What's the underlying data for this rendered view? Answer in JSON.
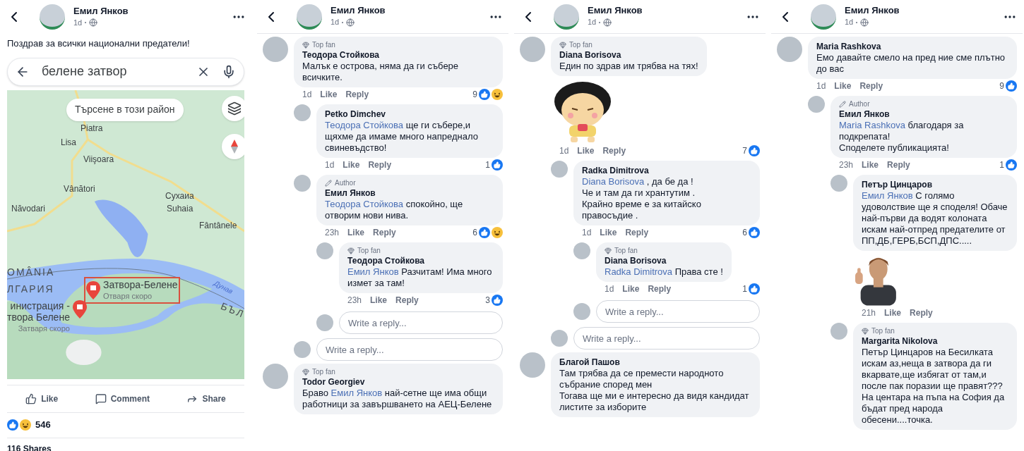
{
  "panels": [
    {
      "kind": "post",
      "header": {
        "name": "Емил Янков",
        "time": "1d"
      },
      "post": {
        "text": "Поздрав за всички национални предатели!",
        "map": {
          "search": {
            "value": "белене затвор"
          },
          "area_button": "Търсене в този район",
          "labels": [
            {
              "kind": "town",
              "text": "Piatra"
            },
            {
              "kind": "town",
              "text": "Lisa"
            },
            {
              "kind": "town",
              "text": "Viişoara"
            },
            {
              "kind": "town",
              "text": "Vânători"
            },
            {
              "kind": "town",
              "text": "Năvodari"
            },
            {
              "kind": "town",
              "text": "Сухаиа"
            },
            {
              "kind": "town",
              "text": "Suhaia"
            },
            {
              "kind": "town",
              "text": "Fântânele"
            },
            {
              "kind": "country",
              "text": "OMÂNIA"
            },
            {
              "kind": "country",
              "text": "ЛГАРИЯ"
            },
            {
              "kind": "river",
              "text": "Дунав"
            },
            {
              "kind": "country",
              "text": "БЪЛ"
            }
          ],
          "places": [
            {
              "name": "Затвора-Белене",
              "status": "Отваря скоро",
              "highlighted": true
            },
            {
              "name": "инистрация -\nтвора Белене",
              "status": "Затваря скоро",
              "highlighted": false
            }
          ]
        },
        "actions": [
          {
            "kind": "like",
            "label": "Like"
          },
          {
            "kind": "comment",
            "label": "Comment"
          },
          {
            "kind": "share",
            "label": "Share"
          }
        ],
        "reactions": [
          {
            "kind": "like"
          },
          {
            "kind": "haha"
          }
        ],
        "reaction_count": "546",
        "shares": "116 Shares"
      }
    },
    {
      "kind": "comments",
      "header": {
        "name": "Емил Янков",
        "time": "1d"
      },
      "comments": [
        {
          "badge": {
            "kind": "top_fan",
            "label": "Top fan"
          },
          "name": "Теодора Стойкова",
          "text": "Малък е острова, няма да ги събере всичките.",
          "time": "1d",
          "actions": [
            "Like",
            "Reply"
          ],
          "count": "9",
          "reactions": [
            {
              "kind": "like"
            },
            {
              "kind": "haha"
            }
          ],
          "replies": [
            {
              "name": "Petko Dimchev",
              "mention": "Теодора Стойкова",
              "text": "ще ги събере,и щяхме да имаме много напреднало свиневъдство!",
              "time": "1d",
              "actions": [
                "Like",
                "Reply"
              ],
              "count": "1",
              "reactions": [
                {
                  "kind": "like"
                }
              ]
            },
            {
              "badge": {
                "kind": "author",
                "label": "Author"
              },
              "name": "Емил Янков",
              "mention": "Теодора Стойкова",
              "text": "спокойно, ще отворим нови нива.",
              "time": "23h",
              "actions": [
                "Like",
                "Reply"
              ],
              "count": "6",
              "reactions": [
                {
                  "kind": "like"
                },
                {
                  "kind": "haha"
                }
              ],
              "replies": [
                {
                  "badge": {
                    "kind": "top_fan",
                    "label": "Top fan"
                  },
                  "name": "Теодора Стойкова",
                  "mention": "Емил Янков",
                  "text": "Разчитам! Има много измет за там!",
                  "time": "23h",
                  "actions": [
                    "Like",
                    "Reply"
                  ],
                  "count": "3",
                  "reactions": [
                    {
                      "kind": "like"
                    }
                  ]
                }
              ],
              "reply_box": {
                "placeholder": "Write a reply..."
              }
            }
          ],
          "reply_box": {
            "placeholder": "Write a reply..."
          }
        },
        {
          "badge": {
            "kind": "top_fan",
            "label": "Top fan"
          },
          "name": "Todor Georgiev",
          "prefix": "Браво",
          "mention": "Емил Янков",
          "text": "най-сетне ще има общи работници за завършването на АЕЦ-Белене"
        }
      ]
    },
    {
      "kind": "comments",
      "header": {
        "name": "Емил Янков",
        "time": "1d"
      },
      "comments": [
        {
          "badge": {
            "kind": "top_fan",
            "label": "Top fan"
          },
          "name": "Diana Borisova",
          "text": "Един по здрав им трябва на тях!",
          "sticker": {
            "kind": "girl"
          },
          "time": "1d",
          "actions": [
            "Like",
            "Reply"
          ],
          "count": "7",
          "reactions": [
            {
              "kind": "like"
            }
          ],
          "replies": [
            {
              "name": "Radka Dimitrova",
              "mention": "Diana Borisova",
              "text": ", да бе да !\nЧе и там да ги хрантутим .\nКрайно време е за китайско правосъдие .",
              "time": "1d",
              "actions": [
                "Like",
                "Reply"
              ],
              "count": "6",
              "reactions": [
                {
                  "kind": "like"
                }
              ],
              "replies": [
                {
                  "badge": {
                    "kind": "top_fan",
                    "label": "Top fan"
                  },
                  "name": "Diana Borisova",
                  "mention": "Radka Dimitrova",
                  "text": "Права сте !",
                  "time": "1d",
                  "actions": [
                    "Like",
                    "Reply"
                  ],
                  "count": "1",
                  "reactions": [
                    {
                      "kind": "like"
                    }
                  ]
                }
              ],
              "reply_box": {
                "placeholder": "Write a reply..."
              }
            }
          ],
          "reply_box": {
            "placeholder": "Write a reply..."
          }
        },
        {
          "name": "Благой Пашов",
          "text": "Там трябва да се премести народното събрание според мен\nТогава ще ми е интересно да видя кандидат листите за изборите"
        }
      ]
    },
    {
      "kind": "comments",
      "header": {
        "name": "Емил Янков",
        "time": "1d"
      },
      "comments": [
        {
          "name": "Maria Rashkova",
          "text": "Емо давайте смело на пред ние сме плътно до вас",
          "time": "1d",
          "actions": [
            "Like",
            "Reply"
          ],
          "count": "9",
          "reactions": [
            {
              "kind": "like"
            }
          ],
          "replies": [
            {
              "badge": {
                "kind": "author",
                "label": "Author"
              },
              "name": "Емил Янков",
              "mention": "Maria Rashkova",
              "text": "благодаря за подкрепата!\nСподелете публикацията!",
              "time": "23h",
              "actions": [
                "Like",
                "Reply"
              ],
              "count": "1",
              "reactions": [
                {
                  "kind": "like"
                }
              ],
              "replies": [
                {
                  "name": "Петър Цинцаров",
                  "mention": "Емил Янков",
                  "text": "С голямо удоволствие ще я споделя! Обаче най-първи да водят колоната искам най-отпред предателите от ПП,ДБ,ГЕРБ,БСП,ДПС.....",
                  "sticker": {
                    "kind": "man"
                  },
                  "time": "21h",
                  "actions": [
                    "Like",
                    "Reply"
                  ]
                },
                {
                  "badge": {
                    "kind": "top_fan",
                    "label": "Top fan"
                  },
                  "name": "Margarita Nikolova",
                  "text": "Петър Цинцаров на Бесилката искам аз,неща в затвора да ги вкарвате,ще избягат от там,и после пак поразии ще правят???\nНа центара на пъпа на София да бъдат пред народа обесени....точка."
                }
              ]
            }
          ]
        }
      ]
    }
  ]
}
